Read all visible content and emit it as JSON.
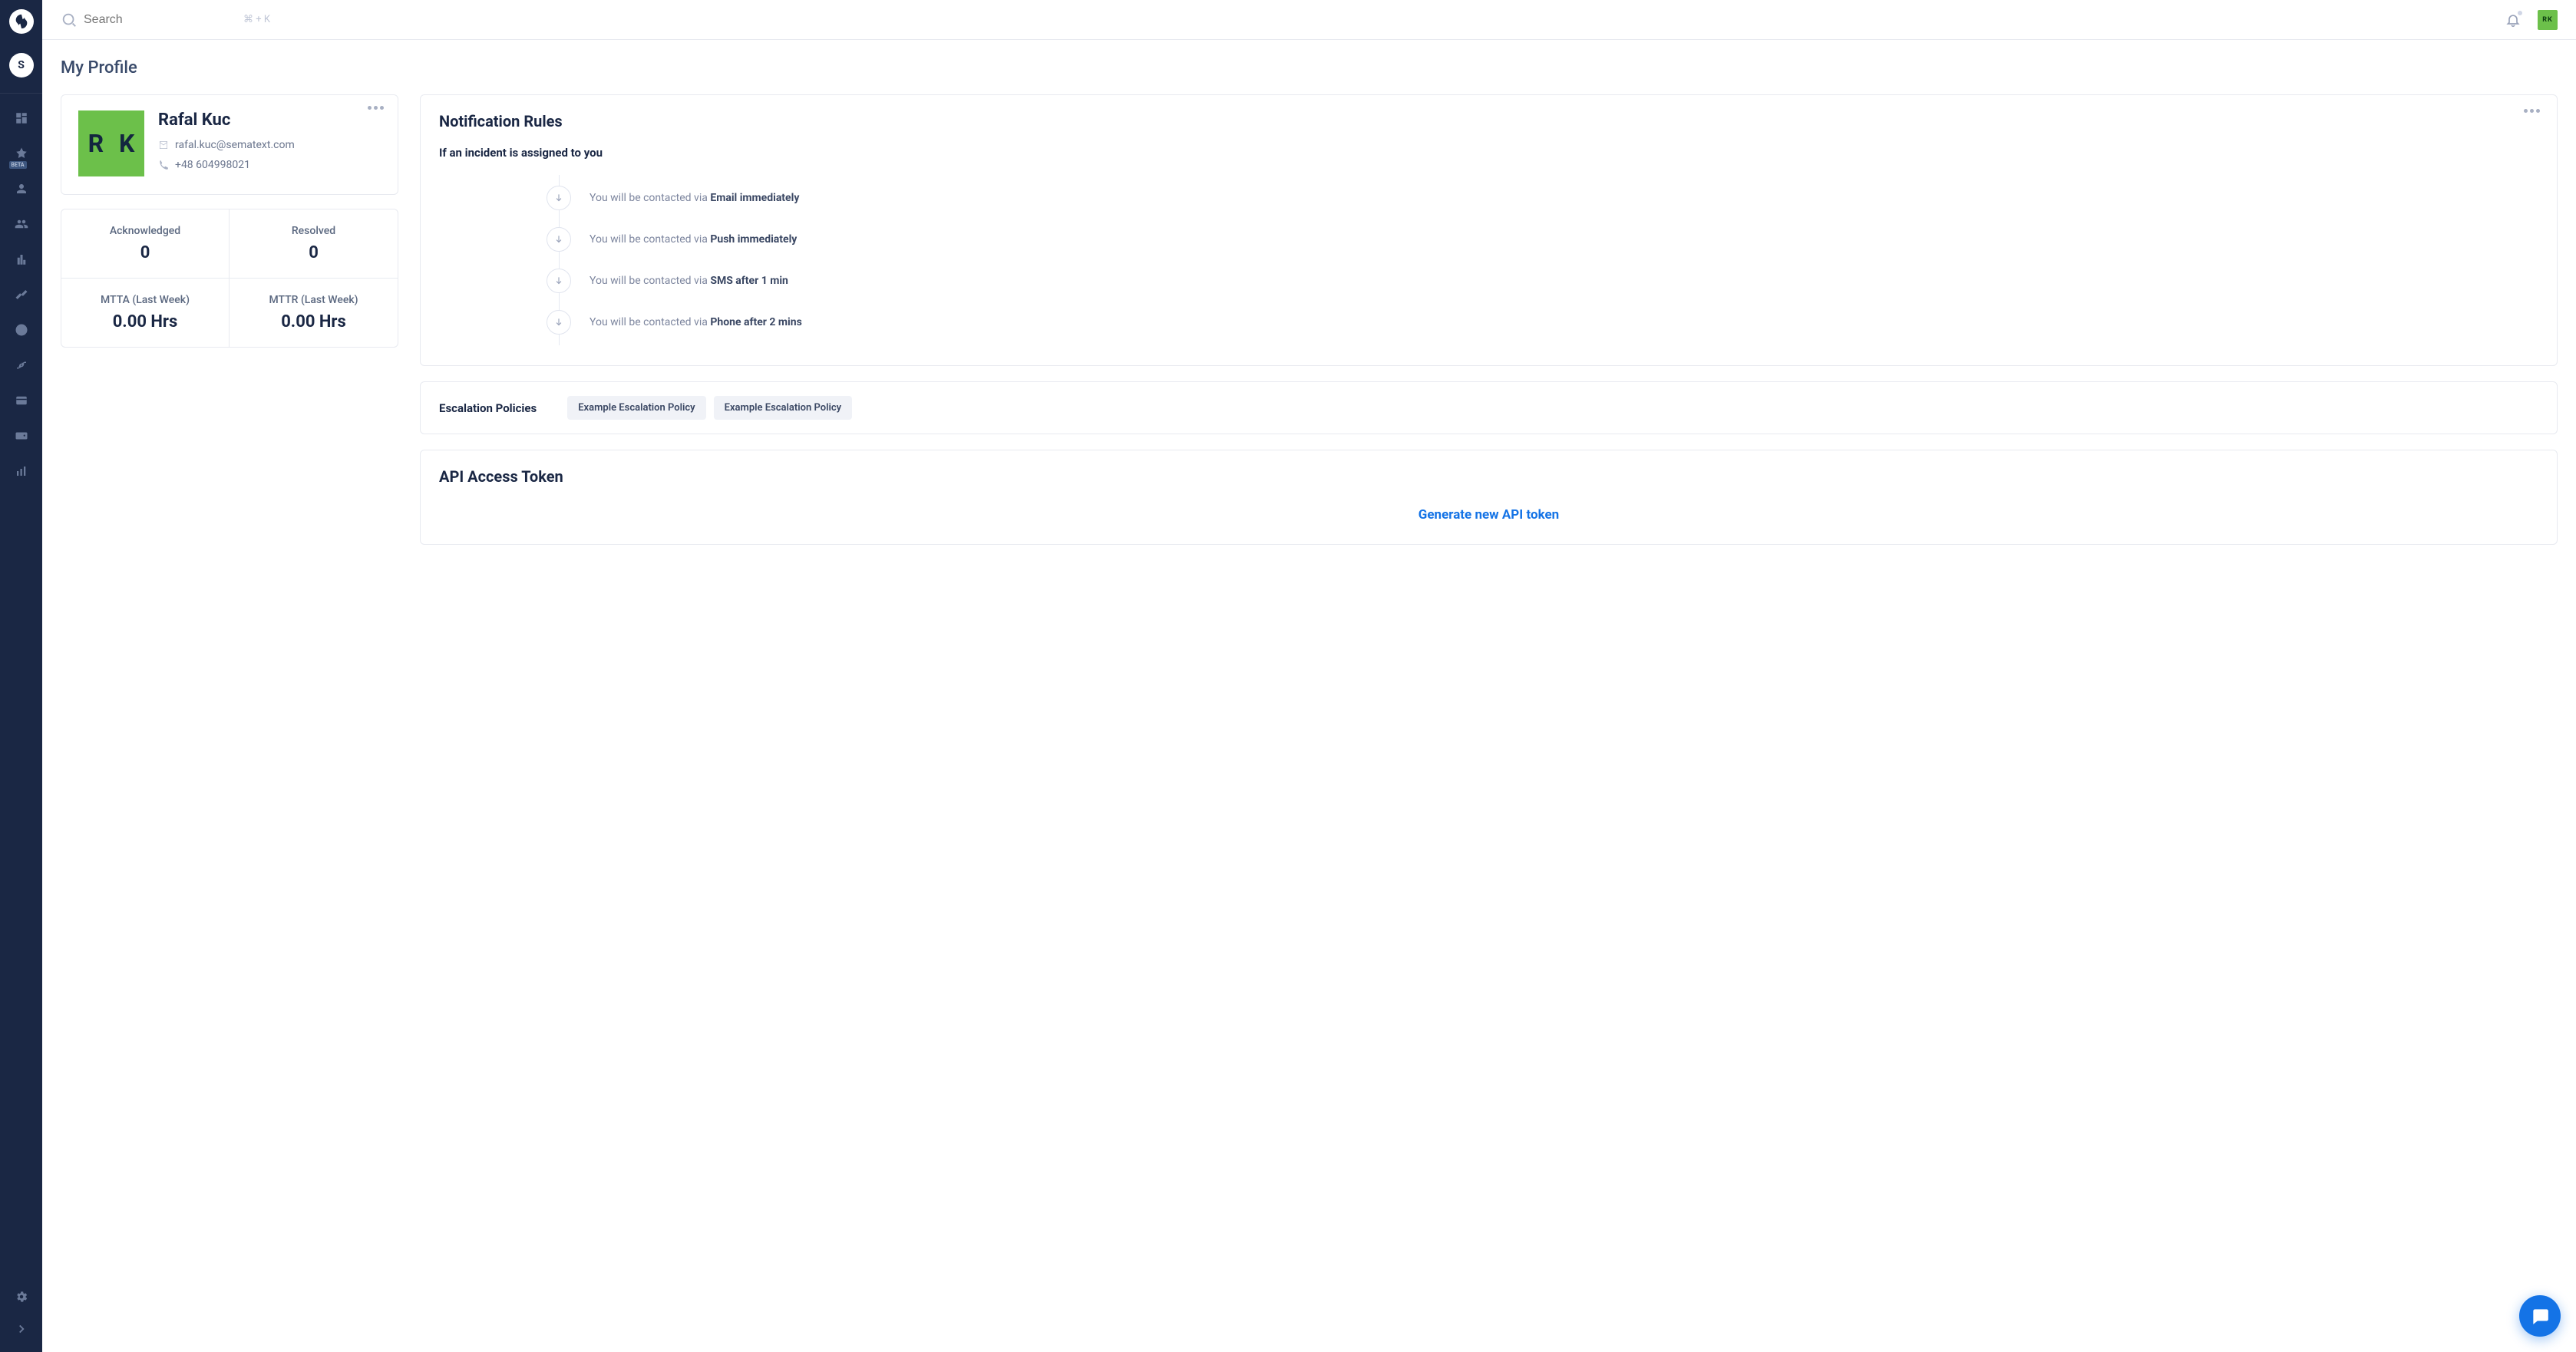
{
  "sidebar": {
    "org_initial": "S",
    "beta_label": "BETA"
  },
  "topbar": {
    "search_placeholder": "Search",
    "kbd_hint": "⌘ + K",
    "avatar_initials": "RK"
  },
  "page": {
    "title": "My Profile"
  },
  "profile": {
    "avatar_initials": "R K",
    "name": "Rafal Kuc",
    "email": "rafal.kuc@sematext.com",
    "phone": "+48 604998021"
  },
  "stats": {
    "ack_label": "Acknowledged",
    "ack_value": "0",
    "resolved_label": "Resolved",
    "resolved_value": "0",
    "mtta_label": "MTTA (Last Week)",
    "mtta_value": "0.00 Hrs",
    "mttr_label": "MTTR (Last Week)",
    "mttr_value": "0.00 Hrs"
  },
  "rules": {
    "title": "Notification Rules",
    "subheading": "If an incident is assigned to you",
    "prefix": "You will be contacted via ",
    "steps": [
      "Email immediately",
      "Push immediately",
      "SMS after 1 min",
      "Phone after 2 mins"
    ]
  },
  "escalation": {
    "label": "Escalation Policies",
    "chips": [
      "Example Escalation Policy",
      "Example Escalation Policy"
    ]
  },
  "api": {
    "title": "API Access Token",
    "link": "Generate new API token"
  }
}
